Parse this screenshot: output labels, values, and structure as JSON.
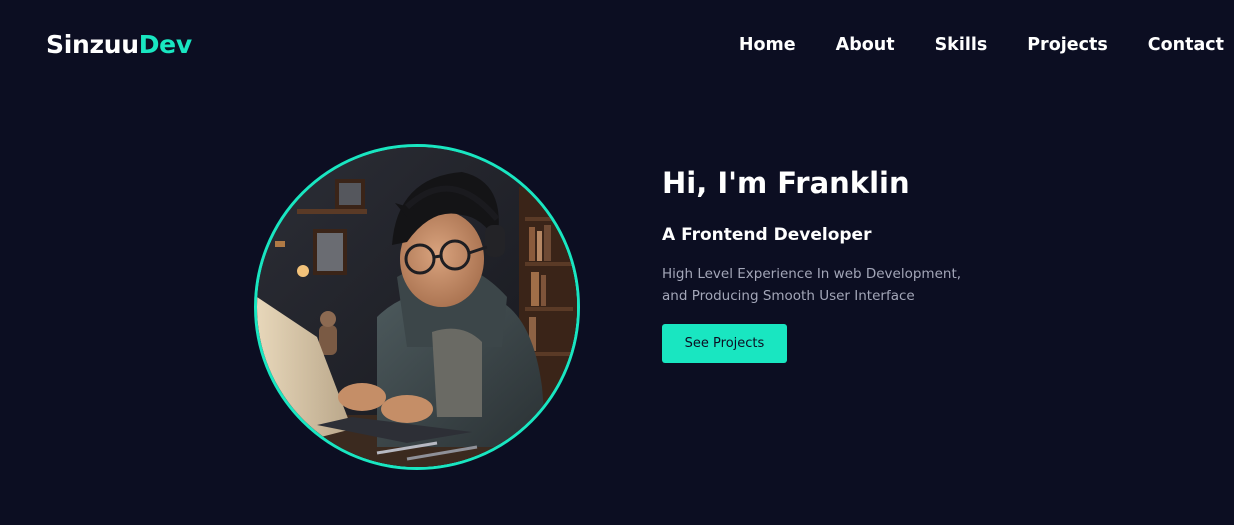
{
  "brand": {
    "logo_part1": "Sinzuu",
    "logo_part2": "Dev",
    "accent_color": "#19e6c1",
    "background_color": "#0c0e22"
  },
  "nav": {
    "items": [
      {
        "label": "Home"
      },
      {
        "label": "About"
      },
      {
        "label": "Skills"
      },
      {
        "label": "Projects"
      },
      {
        "label": "Contact"
      }
    ]
  },
  "hero": {
    "title": "Hi, I'm Franklin",
    "subtitle": "A Frontend Developer",
    "description_line1": "High Level Experience In web Development,",
    "description_line2": "and Producing Smooth User Interface",
    "cta_label": "See Projects",
    "avatar_icon": "profile-photo-boy-coding-on-laptop"
  }
}
